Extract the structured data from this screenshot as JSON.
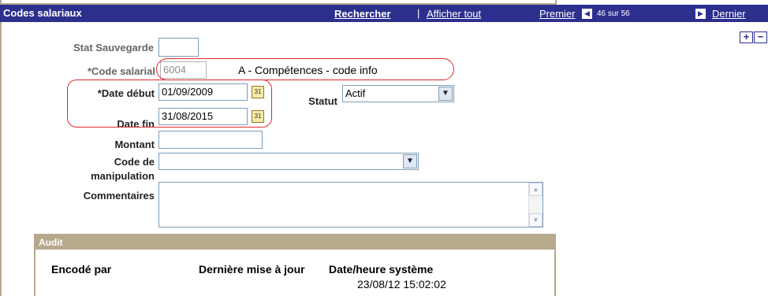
{
  "header": {
    "title": "Codes salariaux",
    "rechercher": "Rechercher",
    "separator": "|",
    "afficher_tout": "Afficher tout",
    "premier": "Premier",
    "counter": "46 sur 56",
    "dernier": "Dernier",
    "prev_icon": "arrow-left-icon",
    "next_icon": "arrow-right-icon",
    "color": "#2d2f8e"
  },
  "row_actions": {
    "add": "+",
    "delete": "−"
  },
  "form": {
    "stat_sauvegarde": {
      "label": "Stat Sauvegarde",
      "value": ""
    },
    "code_salarial": {
      "label": "*Code salarial",
      "value": "6004",
      "description": "A - Compétences - code info"
    },
    "date_debut": {
      "label": "*Date début",
      "value": "01/09/2009"
    },
    "date_fin": {
      "label": "Date fin",
      "value": "31/08/2015"
    },
    "statut": {
      "label": "Statut",
      "value": "Actif"
    },
    "montant": {
      "label": "Montant",
      "value": ""
    },
    "code_manipulation": {
      "label_line1": "Code de",
      "label_line2": "manipulation",
      "value": ""
    },
    "commentaires": {
      "label": "Commentaires",
      "value": ""
    },
    "calendar_icon_text": "31"
  },
  "audit": {
    "title": "Audit",
    "encode_par": "Encodé par",
    "derniere_maj": "Dernière mise à jour",
    "date_heure_systeme": "Date/heure système",
    "timestamp": "23/08/12 15:02:02",
    "border_color": "#b6a98c"
  },
  "highlight_color": "#e0292b"
}
